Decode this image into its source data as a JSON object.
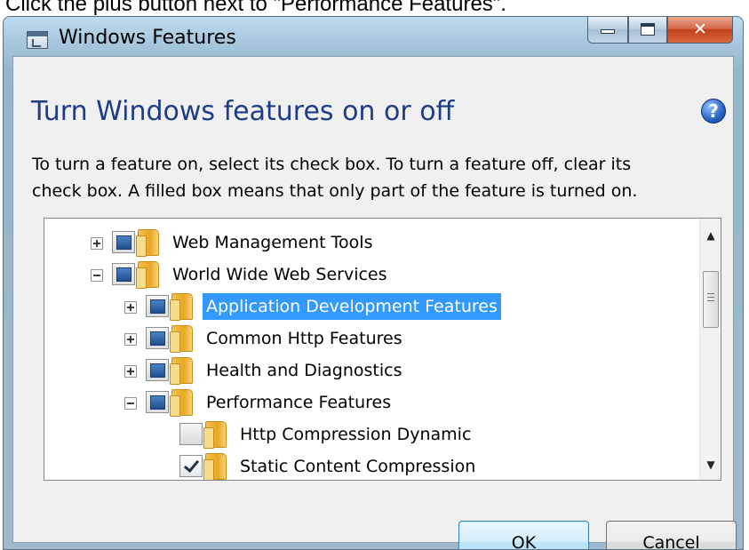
{
  "instruction": "Click the plus button next to \"Performance Features\".",
  "window": {
    "title": "Windows Features",
    "heading": "Turn Windows features on or off",
    "description_lines": [
      "To turn a feature on, select its check box. To turn a feature off, clear its",
      "check box. A filled box means that only part of the feature is turned on."
    ],
    "help_glyph": "?"
  },
  "tree": {
    "items": [
      {
        "label": "Web Management Tools",
        "expander": "plus",
        "check": "partial",
        "level": 0
      },
      {
        "label": "World Wide Web Services",
        "expander": "minus",
        "check": "partial",
        "level": 0
      },
      {
        "label": "Application Development Features",
        "expander": "plus",
        "check": "partial",
        "level": 1,
        "selected": true
      },
      {
        "label": "Common Http Features",
        "expander": "plus",
        "check": "partial",
        "level": 1
      },
      {
        "label": "Health and Diagnostics",
        "expander": "plus",
        "check": "partial",
        "level": 1
      },
      {
        "label": "Performance Features",
        "expander": "minus",
        "check": "partial",
        "level": 1
      },
      {
        "label": "Http Compression Dynamic",
        "expander": "none",
        "check": "unchecked",
        "level": 2
      },
      {
        "label": "Static Content Compression",
        "expander": "none",
        "check": "checked",
        "level": 2
      }
    ]
  },
  "buttons": {
    "ok": "OK",
    "cancel": "Cancel"
  },
  "colors": {
    "selection": "#3399ff",
    "heading": "#1e3c87",
    "close": "#c3421d"
  }
}
